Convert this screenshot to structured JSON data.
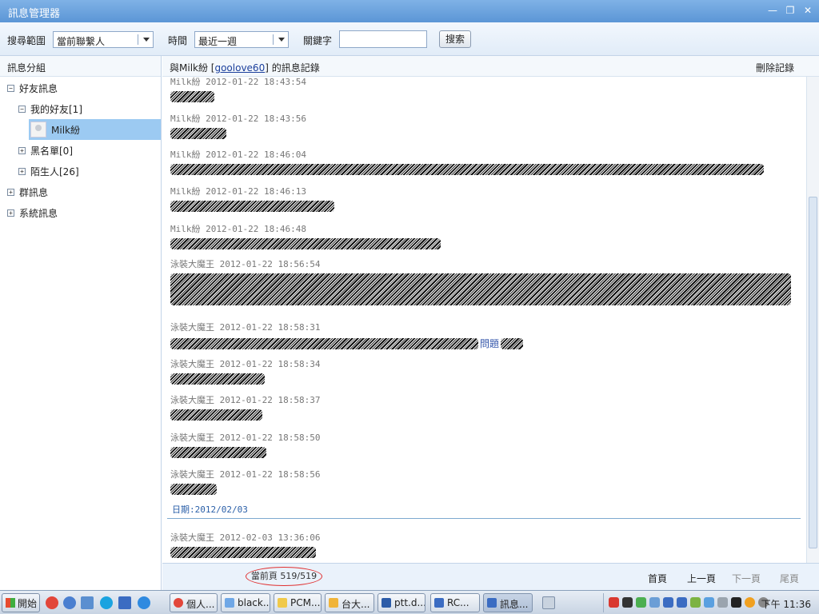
{
  "window": {
    "title": "訊息管理器",
    "controls": {
      "minimize": "—",
      "restore": "❐",
      "close": "✕"
    }
  },
  "search": {
    "scope_label": "搜尋範圍",
    "scope_value": "當前聯繫人",
    "time_label": "時間",
    "time_value": "最近一週",
    "keyword_label": "關鍵字",
    "keyword_value": "",
    "search_button": "搜索"
  },
  "sidebar": {
    "header": "訊息分組",
    "tree": {
      "friends": {
        "toggle": "−",
        "label": "好友訊息"
      },
      "my_friends": {
        "toggle": "−",
        "label": "我的好友[1]"
      },
      "contact": {
        "label": "Milk紛"
      },
      "blacklist": {
        "toggle": "+",
        "label": "黑名單[0]"
      },
      "strangers": {
        "toggle": "+",
        "label": "陌生人[26]"
      },
      "groups": {
        "toggle": "+",
        "label": "群訊息"
      },
      "system": {
        "toggle": "+",
        "label": "系統訊息"
      }
    }
  },
  "record": {
    "title_prefix": "與Milk紛 [",
    "title_link": "goolove60",
    "title_suffix": "] 的訊息記錄",
    "delete": "刪除記錄",
    "messages": [
      {
        "header": "Milk紛 2012-01-22 18:43:54"
      },
      {
        "header": "Milk紛 2012-01-22 18:43:56"
      },
      {
        "header": "Milk紛 2012-01-22 18:46:04"
      },
      {
        "header": "Milk紛 2012-01-22 18:46:13"
      },
      {
        "header": "Milk紛 2012-01-22 18:46:48"
      },
      {
        "header": "泳裝大魔王 2012-01-22 18:56:54"
      },
      {
        "header": "泳裝大魔王 2012-01-22 18:58:31",
        "visible_text": "問題"
      },
      {
        "header": "泳裝大魔王 2012-01-22 18:58:34"
      },
      {
        "header": "泳裝大魔王 2012-01-22 18:58:37"
      },
      {
        "header": "泳裝大魔王 2012-01-22 18:58:50"
      },
      {
        "header": "泳裝大魔王 2012-01-22 18:58:56"
      },
      {
        "header": "泳裝大魔王 2012-02-03 13:36:06"
      }
    ],
    "date_separator": "日期:2012/02/03"
  },
  "pager": {
    "info": "當前頁 519/519",
    "first": "首頁",
    "prev": "上一頁",
    "next": "下一頁",
    "last": "尾頁"
  },
  "taskbar": {
    "start": "開始",
    "tasks": [
      "個人...",
      "black...",
      "PCM...",
      "台大...",
      "ptt.d...",
      "RC...",
      "訊息..."
    ],
    "clock": "下午 11:36"
  },
  "colors": {
    "titlebar": "#5b96d6",
    "selection": "#9ccaf2",
    "link": "#1b3f9c",
    "date_separator": "#2a5fa8",
    "page_highlight": "#e03030"
  }
}
